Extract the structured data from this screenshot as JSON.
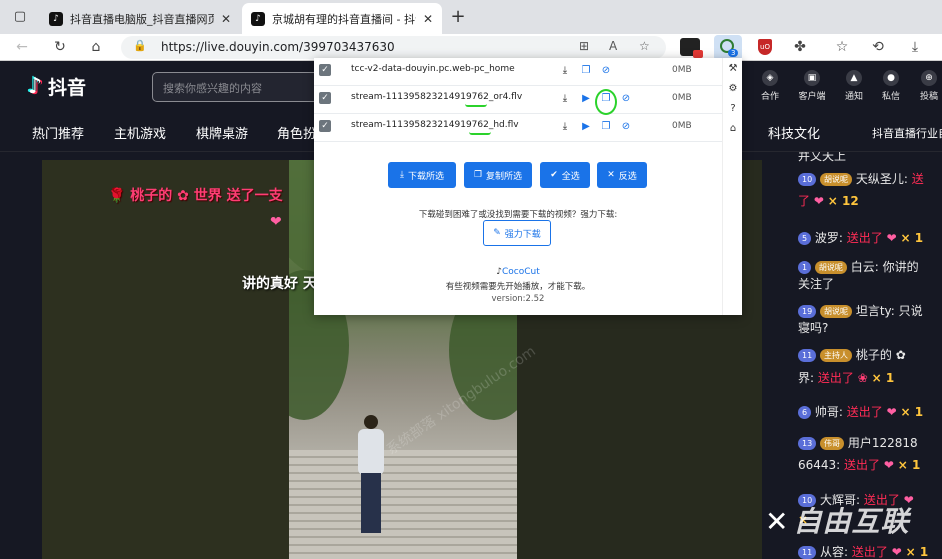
{
  "browser": {
    "tabs": [
      {
        "title": "抖音直播电脑版_抖音直播网页版",
        "favicon": "tiktok-icon"
      },
      {
        "title": "京城胡有理的抖音直播间 - 抖音直播",
        "favicon": "tiktok-icon",
        "active": true
      }
    ],
    "url": "https://live.douyin.com/399703437630",
    "extension_badge": "3"
  },
  "douyin": {
    "logo_text": "抖音",
    "search_placeholder": "搜索你感兴趣的内容",
    "actions": [
      {
        "label": "合作",
        "icon": "cooperate-icon"
      },
      {
        "label": "客户端",
        "icon": "client-icon"
      },
      {
        "label": "通知",
        "icon": "bell-icon"
      },
      {
        "label": "私信",
        "icon": "message-icon"
      },
      {
        "label": "投稿",
        "icon": "upload-icon"
      }
    ],
    "nav": [
      "热门推荐",
      "主机游戏",
      "棋牌桌游",
      "角色扮",
      "科技文化",
      "抖音直播行业自"
    ]
  },
  "danmaku": {
    "line1_a": "🌹 桃子的",
    "line1_b": "世界 送了一支",
    "line3": "讲的真好 天"
  },
  "chat": {
    "messages": [
      {
        "text": "并又天上"
      },
      {
        "lvl": "10",
        "fan": "胡说呢",
        "user": "天纵圣儿:",
        "gift": "送",
        "line2": "了",
        "mult": "× 12"
      },
      {
        "lvl": "5",
        "user": "波罗:",
        "gift": "送出了",
        "mult": "× 1"
      },
      {
        "lvl": "1",
        "fan": "胡说呢",
        "user": "白云:",
        "extra": "你讲的",
        "line2": "关注了"
      },
      {
        "lvl": "19",
        "fan": "胡说呢",
        "user": "坦言ty:",
        "extra": "只说",
        "line2": "寝吗?"
      },
      {
        "lvl": "11",
        "fan": "主持人",
        "user": "桃子的",
        "line2a": "界:",
        "gift": "送出了",
        "mult": "× 1"
      },
      {
        "lvl": "6",
        "user": "帅哥:",
        "gift": "送出了",
        "mult": "× 1"
      },
      {
        "lvl": "13",
        "fan": "伟哥",
        "user": "用户122818",
        "line2a": "66443:",
        "gift": "送出了",
        "mult": "× 1"
      },
      {
        "lvl": "10",
        "user": "大辉哥:",
        "gift": "送出了",
        "line2a": "×"
      },
      {
        "lvl": "11",
        "user": "从容:",
        "gift": "送出了",
        "mult": "× 1"
      }
    ]
  },
  "watermark": {
    "brand": "自由互联",
    "diagonal": "系统部落 xitongbuluo.com"
  },
  "popup": {
    "rows": [
      {
        "name": "tcc-v2-data-douyin.pc.web-pc_home",
        "size": "0MB",
        "checked": true
      },
      {
        "name": "stream-111395823214919762_or4.flv",
        "size": "0MB",
        "checked": true
      },
      {
        "name": "stream-111395823214919762_hd.flv",
        "size": "0MB",
        "checked": true
      }
    ],
    "buttons": {
      "download_selected": "下载所选",
      "copy_selected": "复制所选",
      "select_all": "全选",
      "invert": "反选"
    },
    "message": "下载碰到困难了或没找到需要下载的视频？强力下载:",
    "force_download": "强力下载",
    "brand": "CocoCut",
    "note": "有些视频需要先开始播放，才能下载。",
    "version": "version:2.52"
  }
}
